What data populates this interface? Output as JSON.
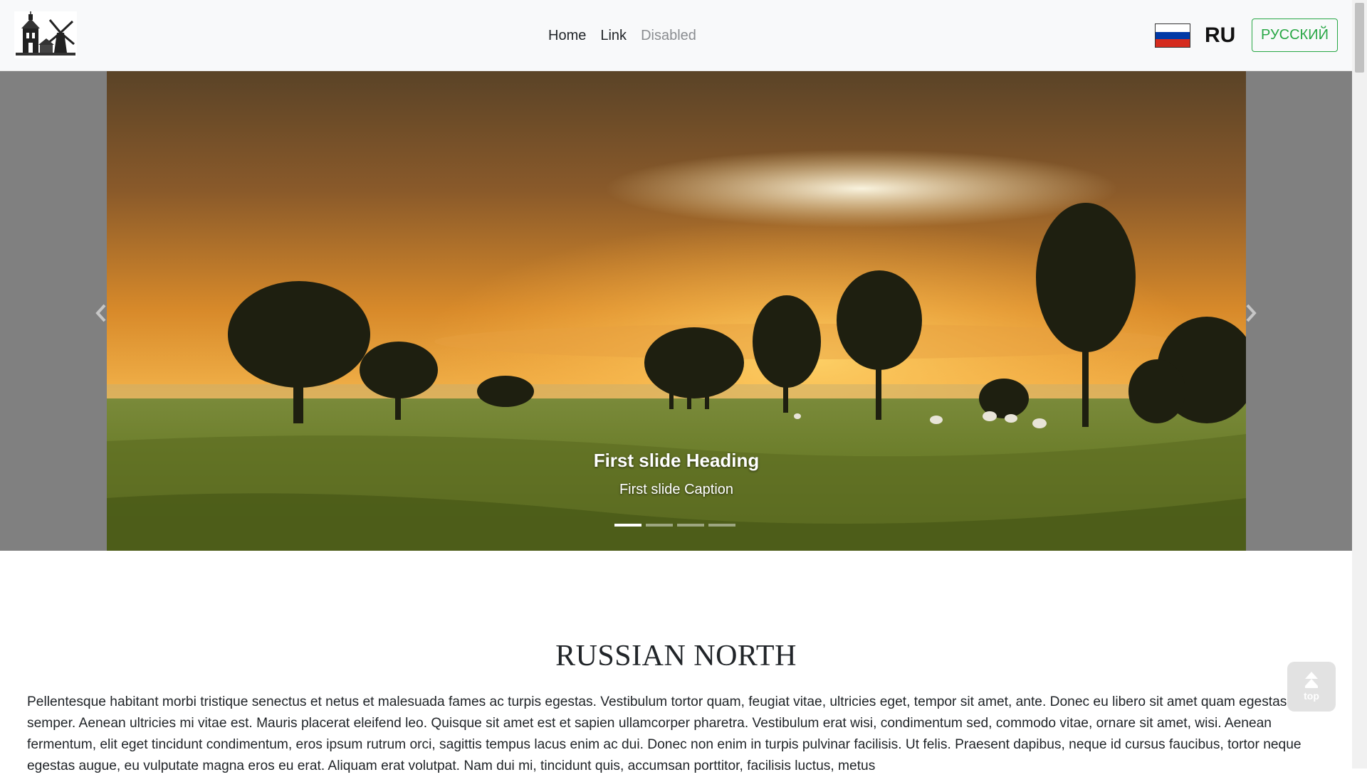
{
  "navbar": {
    "logo_alt": "logo",
    "links": {
      "home": "Home",
      "link": "Link",
      "disabled": "Disabled"
    },
    "language": {
      "flag_icon": "russia-flag-icon",
      "code": "RU",
      "button_label": "РУССКИЙ",
      "accent_color": "#28a745"
    }
  },
  "carousel": {
    "slide": {
      "heading": "First slide Heading",
      "caption": "First slide Caption"
    },
    "indicator_count": 4,
    "active_indicator": 1,
    "prev_icon": "chevron-left-icon",
    "next_icon": "chevron-right-icon"
  },
  "content": {
    "title": "RUSSIAN NORTH",
    "paragraph": "Pellentesque habitant morbi tristique senectus et netus et malesuada fames ac turpis egestas. Vestibulum tortor quam, feugiat vitae, ultricies eget, tempor sit amet, ante. Donec eu libero sit amet quam egestas semper. Aenean ultricies mi vitae est. Mauris placerat eleifend leo. Quisque sit amet est et sapien ullamcorper pharetra. Vestibulum erat wisi, condimentum sed, commodo vitae, ornare sit amet, wisi. Aenean fermentum, elit eget tincidunt condimentum, eros ipsum rutrum orci, sagittis tempus lacus enim ac dui. Donec non enim in turpis pulvinar facilisis. Ut felis. Praesent dapibus, neque id cursus faucibus, tortor neque egestas augue, eu vulputate magna eros eu erat. Aliquam erat volutpat. Nam dui mi, tincidunt quis, accumsan porttitor, facilisis luctus, metus"
  },
  "back_to_top": {
    "label": "top",
    "icon": "double-arrow-up-icon"
  }
}
